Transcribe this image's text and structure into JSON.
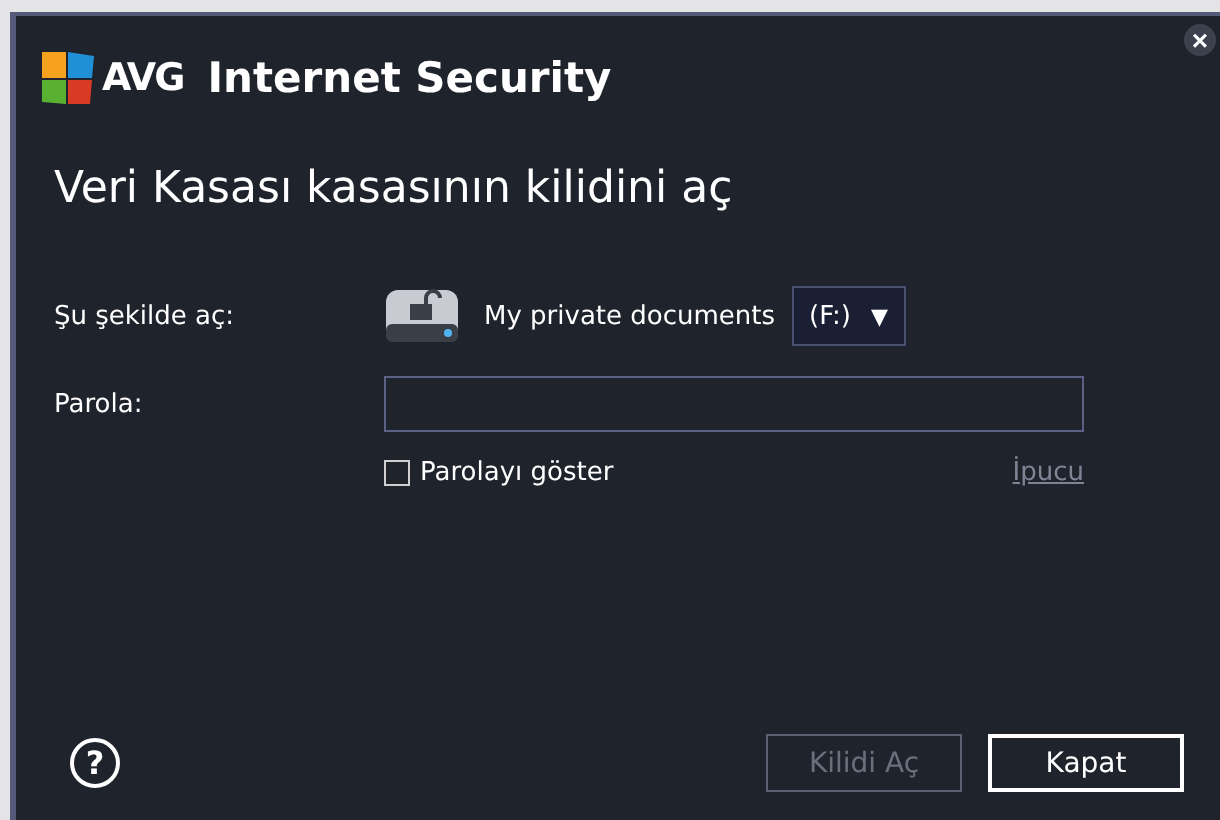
{
  "window": {
    "brand": "AVG",
    "product": "Internet Security",
    "close": "×"
  },
  "heading": "Veri Kasası kasasının kilidini aç",
  "open_as": {
    "label": "Şu şekilde aç:",
    "vault_name": "My private documents",
    "drive": "(F:)",
    "dropdown_arrow": "▼"
  },
  "password": {
    "label": "Parola:"
  },
  "show_password": {
    "label": "Parolayı göster",
    "checked": false
  },
  "hint_link": "İpucu",
  "help": "?",
  "buttons": [
    {
      "label": "Kilidi Aç",
      "disabled": true
    },
    {
      "label": "Kapat",
      "disabled": false
    }
  ]
}
